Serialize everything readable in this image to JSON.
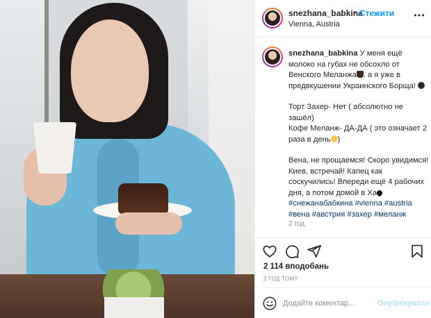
{
  "post": {
    "username": "snezhana_babkina",
    "separator": "•",
    "follow_label": "Стежити",
    "location": "Vienna, Austria",
    "caption": {
      "author": "snezhana_babkina",
      "line1": "У меня ещё молоко на губах не обсохло от Венского Меланжа",
      "line1b": ", а я уже в предвкушении Украинского Борща!",
      "line2": "Торт Захер- Нет ( абсолютно не зашёл)",
      "line3": "Кофе Меланж- ДА-ДА ( это означает 2 раза в день",
      "line3b": ")",
      "line4": "Вена, не прощаемся! Скоро увидимся! Киев, встречай! Капец как соскучились! Впереди ещё 4 рабочих дня, а потом домой в Ха",
      "hashtags": "#снежанабабкина #vienna #austria #вена #австрия #захер #меланж"
    },
    "comment_time": "2 год.",
    "likes": "2 114 вподобань",
    "posted_ago": "2 ГОД ТОМУ",
    "comment_placeholder": "Додайте коментар...",
    "publish_label": "Опублікувати"
  },
  "icons": {
    "more": "more-options-icon",
    "like": "heart-icon",
    "comment": "comment-bubble-icon",
    "share": "paper-plane-icon",
    "save": "bookmark-icon",
    "emoji": "smiley-icon"
  },
  "colors": {
    "accent": "#0095f6",
    "publish_disabled": "#b2dffc",
    "muted": "#8e8e8e",
    "text": "#262626",
    "hashtag": "#00376b"
  }
}
